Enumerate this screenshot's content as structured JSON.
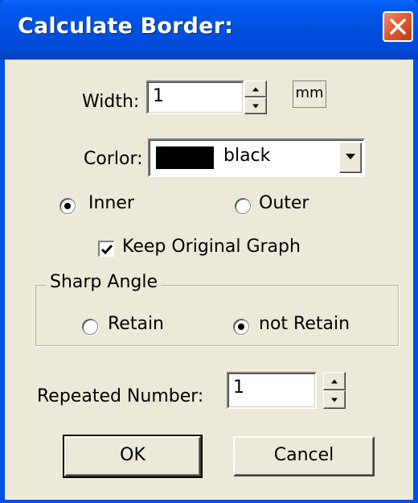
{
  "window": {
    "title": "Calculate Border:"
  },
  "width": {
    "label": "Width:",
    "value": "1",
    "unit": "mm"
  },
  "color": {
    "label": "Corlor:",
    "swatch": "#000000",
    "value": "black"
  },
  "position": {
    "inner_label": "Inner",
    "outer_label": "Outer",
    "selected": "Inner"
  },
  "keep_original": {
    "label": "Keep Original Graph",
    "checked": true
  },
  "sharp_angle": {
    "title": "Sharp Angle",
    "retain_label": "Retain",
    "not_retain_label": "not Retain",
    "selected": "not Retain"
  },
  "repeated": {
    "label": "Repeated Number:",
    "value": "1"
  },
  "buttons": {
    "ok": "OK",
    "cancel": "Cancel"
  },
  "theme": {
    "titlebar": "#0050dd",
    "face": "#ece9d8",
    "close": "#e25a34"
  }
}
